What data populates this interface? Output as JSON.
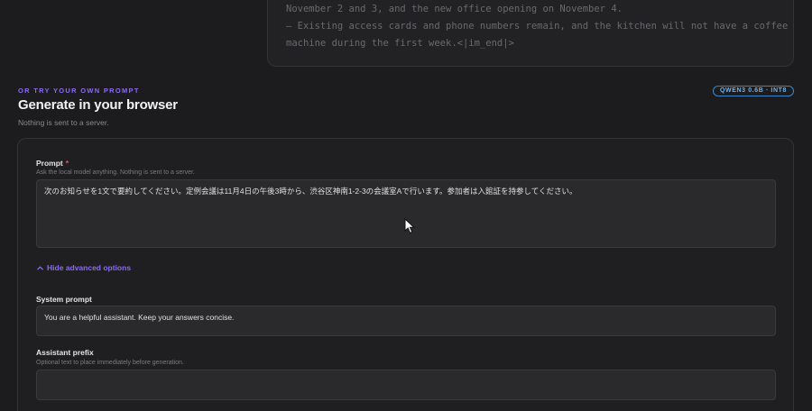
{
  "output": {
    "lines": [
      "November 2 and 3, and the new office opening on November 4.",
      "– Existing access cards and phone numbers remain, and the kitchen will not have a coffee",
      "machine during the first week.<|im_end|>"
    ]
  },
  "section": {
    "eyebrow": "OR TRY YOUR OWN PROMPT",
    "title": "Generate in your browser",
    "subtitle": "Nothing is sent to a server.",
    "model_badge": "QWEN3 0.6B · INT8"
  },
  "prompt": {
    "label": "Prompt",
    "required_mark": "*",
    "hint": "Ask the local model anything. Nothing is sent to a server.",
    "value": "次のお知らせを1文で要約してください。定例会議は11月4日の午後3時から、渋谷区神南1-2-3の会議室Aで行います。参加者は入館証を持参してください。"
  },
  "advanced_toggle": {
    "label": "Hide advanced options",
    "icon": "chevron-up-icon"
  },
  "system_prompt": {
    "label": "System prompt",
    "value": "You are a helpful assistant. Keep your answers concise."
  },
  "assistant_prefix": {
    "label": "Assistant prefix",
    "hint": "Optional text to place immediately before generation.",
    "value": ""
  },
  "colors": {
    "accent": "#8b6cf0",
    "badge": "#6fb3ec",
    "required": "#e05a6a"
  }
}
